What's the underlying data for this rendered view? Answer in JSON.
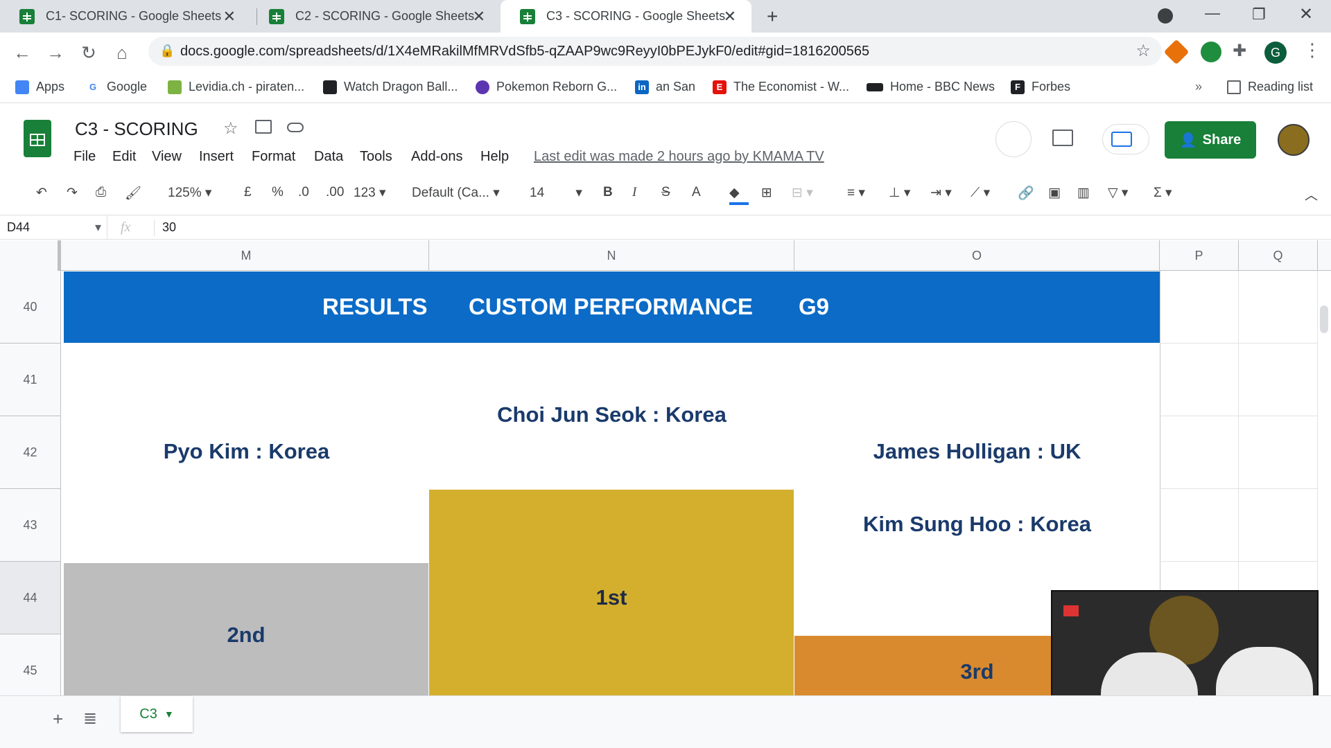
{
  "browser": {
    "tabs": [
      {
        "title": "C1- SCORING - Google Sheets"
      },
      {
        "title": "C2 - SCORING - Google Sheets"
      },
      {
        "title": "C3 - SCORING - Google Sheets"
      }
    ],
    "url": "docs.google.com/spreadsheets/d/1X4eMRakilMfMRVdSfb5-qZAAP9wc9ReyyI0bPEJykF0/edit#gid=1816200565",
    "bookmarks": [
      {
        "label": "Apps",
        "icon": "apps-grid-icon",
        "color": "#4285f4"
      },
      {
        "label": "Google",
        "icon": "google-icon",
        "color": "#4285f4"
      },
      {
        "label": "Levidia.ch - piraten...",
        "icon": "levidia-icon",
        "color": "#7cb342"
      },
      {
        "label": "Watch Dragon Ball...",
        "icon": "tv-icon",
        "color": "#202124"
      },
      {
        "label": "Pokemon Reborn G...",
        "icon": "pokeball-icon",
        "color": "#5e35b1"
      },
      {
        "label": "an San",
        "icon": "linkedin-icon",
        "color": "#0a66c2"
      },
      {
        "label": "The Economist - W...",
        "icon": "economist-icon",
        "color": "#e3120b"
      },
      {
        "label": "Home - BBC News",
        "icon": "bbc-icon",
        "color": "#202124"
      },
      {
        "label": "Forbes",
        "icon": "forbes-icon",
        "color": "#202124"
      }
    ],
    "reading_list": "Reading list",
    "profile_initial": "G"
  },
  "sheets": {
    "title": "C3 - SCORING",
    "menus": [
      "File",
      "Edit",
      "View",
      "Insert",
      "Format",
      "Data",
      "Tools",
      "Add-ons",
      "Help"
    ],
    "last_edit": "Last edit was made 2 hours ago by KMAMA TV",
    "share_label": "Share",
    "toolbar": {
      "zoom": "125%",
      "currency": "£",
      "percent": "%",
      "dec_decrease": ".0",
      "dec_increase": ".00",
      "format_more": "123",
      "font": "Default (Ca...",
      "font_size": "14",
      "bold": "B",
      "italic": "I",
      "strike": "S",
      "textcolor": "A"
    },
    "name_box": "D44",
    "fx": "fx",
    "formula_value": "30",
    "columns": [
      "M",
      "N",
      "O",
      "P",
      "Q"
    ],
    "rows": [
      "40",
      "41",
      "42",
      "43",
      "44",
      "45"
    ],
    "banner": {
      "results": "RESULTS",
      "custom": "CUSTOM PERFORMANCE",
      "group": "G9",
      "color": "#0b6bc7"
    },
    "podium": {
      "first_name": "Choi Jun Seok : Korea",
      "second_name": "Pyo Kim : Korea",
      "third_name_a": "James Holligan : UK",
      "third_name_b": "Kim Sung Hoo : Korea",
      "first_label": "1st",
      "second_label": "2nd",
      "third_label": "3rd",
      "first_color": "#d4af2e",
      "second_color": "#bdbdbd",
      "third_color": "#d98a2e"
    },
    "sheet_tab": "C3"
  }
}
